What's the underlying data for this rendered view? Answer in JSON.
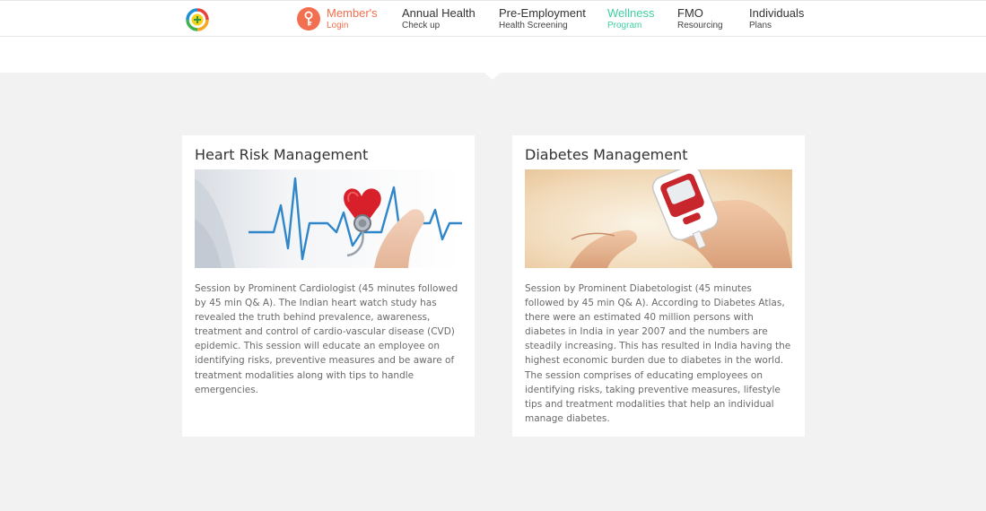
{
  "nav": {
    "items": [
      {
        "title": "Member's",
        "sub": "Login"
      },
      {
        "title": "Annual Health",
        "sub": "Check up"
      },
      {
        "title": "Pre-Employment",
        "sub": "Health Screening"
      },
      {
        "title": "Wellness",
        "sub": "Program"
      },
      {
        "title": "FMO",
        "sub": "Resourcing"
      },
      {
        "title": "Individuals",
        "sub": "Plans"
      }
    ]
  },
  "colors": {
    "member_accent": "#f26f4f",
    "wellness_accent": "#3fcfa2",
    "background": "#f2f2f2"
  },
  "cards": [
    {
      "title": "Heart Risk Management",
      "image": "heart-stethoscope-image",
      "text": "Session by Prominent Cardiologist (45 minutes followed by 45 min Q& A). The Indian heart watch study has revealed the truth behind prevalence, awareness, treatment and control of cardio-vascular disease (CVD) epidemic. This session will educate an employee on identifying risks, preventive measures and be aware of treatment modalities along with tips to handle emergencies."
    },
    {
      "title": "Diabetes Management",
      "image": "glucose-meter-image",
      "text": "Session by Prominent Diabetologist (45 minutes followed by 45 min Q& A). According to Diabetes Atlas, there were an estimated 40 million persons with diabetes in India in year 2007 and the numbers are steadily increasing. This has resulted in India having the highest economic burden due to diabetes in the world. The session comprises of educating employees on identifying risks, taking preventive measures, lifestyle tips and treatment modalities that help an individual manage diabetes."
    }
  ]
}
